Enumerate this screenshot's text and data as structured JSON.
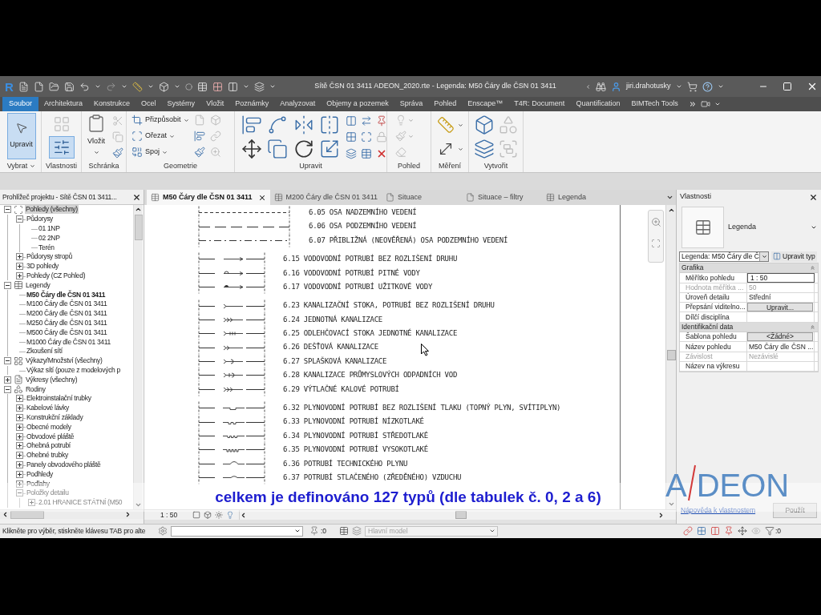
{
  "window": {
    "logo_letter": "R",
    "title": "Sítě ČSN 01 3411 ADEON_2020.rte - Legenda: M50 Čáry dle ČSN 01 3411",
    "user": "jiri.drahotusky"
  },
  "ribbon_tabs": [
    {
      "label": "Soubor",
      "kind": "application"
    },
    {
      "label": "Architektura",
      "kind": "tab"
    },
    {
      "label": "Konstrukce",
      "kind": "tab"
    },
    {
      "label": "Ocel",
      "kind": "tab"
    },
    {
      "label": "Systémy",
      "kind": "tab"
    },
    {
      "label": "Vložit",
      "kind": "tab"
    },
    {
      "label": "Poznámky",
      "kind": "tab"
    },
    {
      "label": "Analyzovat",
      "kind": "tab"
    },
    {
      "label": "Objemy a pozemek",
      "kind": "tab"
    },
    {
      "label": "Správa",
      "kind": "tab"
    },
    {
      "label": "Pohled",
      "kind": "tab"
    },
    {
      "label": "Enscape™",
      "kind": "tab"
    },
    {
      "label": "T4R: Document",
      "kind": "tab"
    },
    {
      "label": "Quantification",
      "kind": "tab"
    },
    {
      "label": "BIMTech Tools",
      "kind": "tab"
    }
  ],
  "ribbon_panels": [
    {
      "kind": "select",
      "label": "Vybrat",
      "buttons": [
        {
          "label": "Upravit",
          "selected": true
        }
      ]
    },
    {
      "kind": "properties",
      "label": "Vlastnosti",
      "buttons": [
        {
          "kind": "type-properties",
          "disabled": true,
          "selected": false
        },
        {
          "kind": "properties",
          "disabled": false,
          "selected": true
        }
      ]
    },
    {
      "kind": "clipboard",
      "label": "Schránka",
      "buttons": [
        {
          "label": "Vložit"
        }
      ]
    },
    {
      "kind": "geometry",
      "label": "Geometrie",
      "buttons": [
        {
          "label": "Přizpůsobit"
        },
        {
          "label": "Ořezat"
        },
        {
          "label": "Spoj"
        }
      ]
    },
    {
      "kind": "modify",
      "label": "Upravit"
    },
    {
      "kind": "view",
      "label": "Pohled"
    },
    {
      "kind": "measure",
      "label": "Měření"
    },
    {
      "kind": "create",
      "label": "Vytvořit"
    }
  ],
  "project_browser": {
    "title": "Prohlížeč projektu - Sítě ČSN 01 3411...",
    "tree": [
      {
        "label": "Pohledy (všechny)",
        "kind": "views",
        "expanded": true,
        "selected": true,
        "current": false,
        "children": [
          {
            "label": "Půdorysy",
            "expanded": true,
            "selected": false,
            "current": false,
            "children": [
              {
                "label": "01 1NP",
                "selected": false,
                "current": false
              },
              {
                "label": "02 2NP",
                "selected": false,
                "current": false
              },
              {
                "label": "Terén",
                "selected": false,
                "current": false
              }
            ]
          },
          {
            "label": "Půdorysy stropů",
            "expanded": false,
            "selected": false,
            "current": false
          },
          {
            "label": "3D pohledy",
            "expanded": false,
            "selected": false,
            "current": false
          },
          {
            "label": "Pohledy (CZ Pohled)",
            "expanded": false,
            "selected": false,
            "current": false
          }
        ]
      },
      {
        "label": "Legendy",
        "kind": "legends",
        "expanded": true,
        "selected": false,
        "current": false,
        "children": [
          {
            "label": "M50 Čáry dle ČSN 01 3411",
            "selected": false,
            "current": true
          },
          {
            "label": "M100 Čáry dle ČSN 01 3411",
            "selected": false,
            "current": false
          },
          {
            "label": "M200 Čáry dle ČSN 01 3411",
            "selected": false,
            "current": false
          },
          {
            "label": "M250 Čáry dle ČSN 01 3411",
            "selected": false,
            "current": false
          },
          {
            "label": "M500 Čáry dle ČSN 01 3411",
            "selected": false,
            "current": false
          },
          {
            "label": "M1000 Čáry dle ČSN 01 3411",
            "selected": false,
            "current": false
          },
          {
            "label": "Zkoušení sítí",
            "selected": false,
            "current": false
          }
        ]
      },
      {
        "label": "Výkazy/Množství (všechny)",
        "kind": "schedules",
        "expanded": true,
        "selected": false,
        "current": false,
        "children": [
          {
            "label": "Výkaz sítí (pouze z modelových p",
            "selected": false,
            "current": false
          }
        ]
      },
      {
        "label": "Výkresy (všechny)",
        "kind": "sheets",
        "expanded": false,
        "selected": false,
        "current": false
      },
      {
        "label": "Rodiny",
        "kind": "families",
        "expanded": true,
        "selected": false,
        "current": false,
        "children": [
          {
            "label": "Elektroinstalační trubky",
            "expanded": false,
            "selected": false,
            "current": false
          },
          {
            "label": "Kabelové lávky",
            "expanded": false,
            "selected": false,
            "current": false
          },
          {
            "label": "Konstrukční základy",
            "expanded": false,
            "selected": false,
            "current": false
          },
          {
            "label": "Obecné modely",
            "expanded": false,
            "selected": false,
            "current": false
          },
          {
            "label": "Obvodové pláště",
            "expanded": false,
            "selected": false,
            "current": false
          },
          {
            "label": "Ohebná potrubí",
            "expanded": false,
            "selected": false,
            "current": false
          },
          {
            "label": "Ohebné trubky",
            "expanded": false,
            "selected": false,
            "current": false
          },
          {
            "label": "Panely obvodového pláště",
            "expanded": false,
            "selected": false,
            "current": false
          },
          {
            "label": "Podhledy",
            "expanded": false,
            "selected": false,
            "current": false
          },
          {
            "label": "Podlahy",
            "expanded": false,
            "selected": false,
            "current": false
          },
          {
            "label": "Položky detailu",
            "expanded": true,
            "selected": false,
            "current": false,
            "children": [
              {
                "label": "2.01 HRANICE STÁTNÍ (M50",
                "expanded": false,
                "selected": false,
                "current": false
              }
            ]
          }
        ]
      }
    ]
  },
  "view_tabs": [
    {
      "label": "M50 Čáry dle ČSN 01 3411",
      "kind": "legend",
      "selected": true
    },
    {
      "label": "M200 Čáry dle ČSN 01 3411",
      "kind": "legend",
      "selected": false
    },
    {
      "label": "Situace",
      "kind": "plan",
      "selected": false
    },
    {
      "label": "Situace – filtry",
      "kind": "plan",
      "selected": false
    },
    {
      "label": "Legenda",
      "kind": "legend",
      "selected": false
    }
  ],
  "legend": {
    "groups": [
      {
        "rows": [
          {
            "kind": "short-dash",
            "label": "6.05 OSA NADZEMNÍHO VEDENÍ"
          },
          {
            "kind": "long-dash",
            "label": "6.06 OSA PODZEMNÍHO VEDENÍ"
          },
          {
            "kind": "dash-dot",
            "label": "6.07 PŘIBLIŽNÁ (NEOVĚŘENÁ) OSA PODZEMNÍHO VEDENÍ"
          }
        ]
      },
      {
        "rows": [
          {
            "kind": "arrow",
            "label": "6.15 VODOVODNÍ POTRUBÍ BEZ ROZLIŠENÍ DRUHU"
          },
          {
            "kind": "arrow-dome",
            "label": "6.16 VODOVODNÍ POTRUBÍ PITNÉ VODY"
          },
          {
            "kind": "arrow-filled-dome",
            "label": "6.17 VODOVODNÍ POTRUBÍ UŽITKOVÉ VODY"
          }
        ]
      },
      {
        "rows": [
          {
            "kind": "chevron",
            "label": "6.23 KANALIZAČNÍ STOKA, POTRUBÍ BEZ ROZLIŠENÍ DRUHU"
          },
          {
            "kind": "triple-chevron",
            "label": "6.24 JEDNOTNÁ KANALIZACE"
          },
          {
            "kind": "crossed-chevron",
            "label": "6.25 ODLEHČOVACÍ STOKA JEDNOTNÉ KANALIZACE"
          },
          {
            "kind": "double-chevron",
            "label": "6.26 DEŠŤOVÁ KANALIZACE"
          },
          {
            "kind": "chevron-bracket",
            "label": "6.27 SPLAŠKOVÁ KANALIZACE"
          },
          {
            "kind": "chevron-tick-bracket",
            "label": "6.28 KANALIZACE PRŮMYSLOVÝCH ODPADNÍCH VOD"
          },
          {
            "kind": "triple-chevron",
            "label": "6.29 VÝTLAČNÉ KALOVÉ POTRUBÍ"
          }
        ]
      },
      {
        "rows": [
          {
            "kind": "notch-1",
            "label": "6.32 PLYNOVODNÍ POTRUBÍ BEZ ROZLIŠENÍ TLAKU (TOPNÝ PLYN, SVÍTIPLYN)"
          },
          {
            "kind": "notch-2",
            "label": "6.33 PLYNOVODNÍ POTRUBÍ NÍZKOTLAKÉ"
          },
          {
            "kind": "notch-3",
            "label": "6.34 PLYNOVODNÍ POTRUBÍ STŘEDOTLAKÉ"
          },
          {
            "kind": "notch-4",
            "label": "6.35 PLYNOVODNÍ POTRUBÍ VYSOKOTLAKÉ"
          },
          {
            "kind": "hump",
            "label": "6.36 POTRUBÍ TECHNICKÉHO PLYNU"
          },
          {
            "kind": "hump-low",
            "label": "6.37 POTRUBÍ STLAČENÉHO (ZŘEDĚNÉHO) VZDUCHU"
          }
        ]
      }
    ]
  },
  "view_control": {
    "scale": "1 : 50"
  },
  "properties": {
    "title": "Vlastnosti",
    "type_name": "Legenda",
    "type_selector": "Legenda: M50 Čáry dle Č",
    "edit_type": "Upravit typ",
    "sections": [
      {
        "label": "Grafika",
        "rows": [
          {
            "label": "Měřítko pohledu",
            "kind": "input",
            "value": "1 : 50",
            "disabled": false
          },
          {
            "label": "Hodnota měřítka ...",
            "kind": "text",
            "value": "50",
            "disabled": true
          },
          {
            "label": "Úroveň detailu",
            "kind": "text",
            "value": "Střední",
            "disabled": false
          },
          {
            "label": "Přepsání viditelno...",
            "kind": "button",
            "value": "Upravit...",
            "disabled": false
          },
          {
            "label": "Dílčí disciplína",
            "kind": "text",
            "disabled": false
          }
        ]
      },
      {
        "label": "Identifikační data",
        "rows": [
          {
            "label": "Šablona pohledu",
            "kind": "button",
            "value": "<Žádné>",
            "disabled": false
          },
          {
            "label": "Název pohledu",
            "kind": "text",
            "value": "M50 Čáry dle ČSN ...",
            "disabled": false
          },
          {
            "label": "Závislost",
            "kind": "text",
            "value": "Nezávislé",
            "disabled": true
          },
          {
            "label": "Název na výkresu",
            "kind": "text",
            "disabled": false
          }
        ]
      }
    ],
    "help_link": "Nápověda k vlastnostem",
    "apply": {
      "label": "Použít",
      "disabled": true
    }
  },
  "status_bar": {
    "prompt": "Klikněte pro výběr, stiskněte klávesu TAB pro alte",
    "editable_count": ":0",
    "model": {
      "value": "Hlavní model",
      "disabled": true
    },
    "filter_count": ":0"
  },
  "caption": "celkem je definováno 127 typů (dle tabulek č. 0, 2 a 6)",
  "logo": {
    "initial": "A",
    "rest": "DEON"
  }
}
